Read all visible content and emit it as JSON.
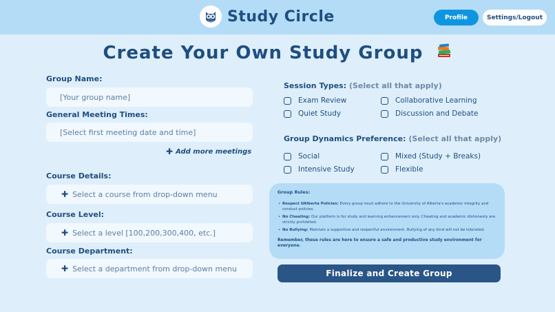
{
  "header": {
    "brand_title": "Study Circle",
    "profile_label": "Profile",
    "settings_label": "Settings/Logout"
  },
  "page_title": "Create Your Own Study Group",
  "form": {
    "group_name_label": "Group Name:",
    "group_name_placeholder": "[Your group name]",
    "meeting_times_label": "General Meeting Times:",
    "meeting_times_placeholder": "[Select first meeting date and time]",
    "add_more_label": "Add more meetings",
    "course_details_label": "Course Details:",
    "course_details_value": "Select a course from drop-down menu",
    "course_level_label": "Course Level:",
    "course_level_value": "Select a level [100,200,300,400, etc.]",
    "course_department_label": "Course Department:",
    "course_department_value": "Select a department from drop-down menu"
  },
  "session_types": {
    "title": "Session Types:",
    "subtitle": "(Select all that apply)",
    "options": [
      "Exam Review",
      "Collaborative Learning",
      "Quiet Study",
      "Discussion and Debate"
    ]
  },
  "group_dynamics": {
    "title": "Group Dynamics Preference:",
    "subtitle": "(Select all that apply)",
    "options": [
      "Social",
      "Mixed (Study + Breaks)",
      "Intensive Study",
      "Flexible"
    ]
  },
  "rules": {
    "title": "Group Rules:",
    "items": [
      {
        "head": "Respect UAlberta Policies:",
        "text": "Every group must adhere to the University of Alberta's academic integrity and conduct policies."
      },
      {
        "head": "No Cheating:",
        "text": "Our platform is for study and learning enhancement only. Cheating and academic dishonesty are strictly prohibited."
      },
      {
        "head": "No Bullying:",
        "text": "Maintain a supportive and respectful environment. Bullying of any kind will not be tolerated."
      }
    ],
    "footer": "Remember, these rules are here to ensure a safe and productive study environment for everyone."
  },
  "finalize_label": "Finalize and Create Group",
  "colors": {
    "background": "#deeffb",
    "header": "#b4dcf7",
    "primary_text": "#1f4e7f",
    "profile_button": "#0f95e0",
    "finalize_button": "#2a5587"
  },
  "icons": {
    "logo": "owl-icon",
    "title": "books-icon",
    "add": "plus-icon",
    "checkbox": "checkbox-icon"
  }
}
